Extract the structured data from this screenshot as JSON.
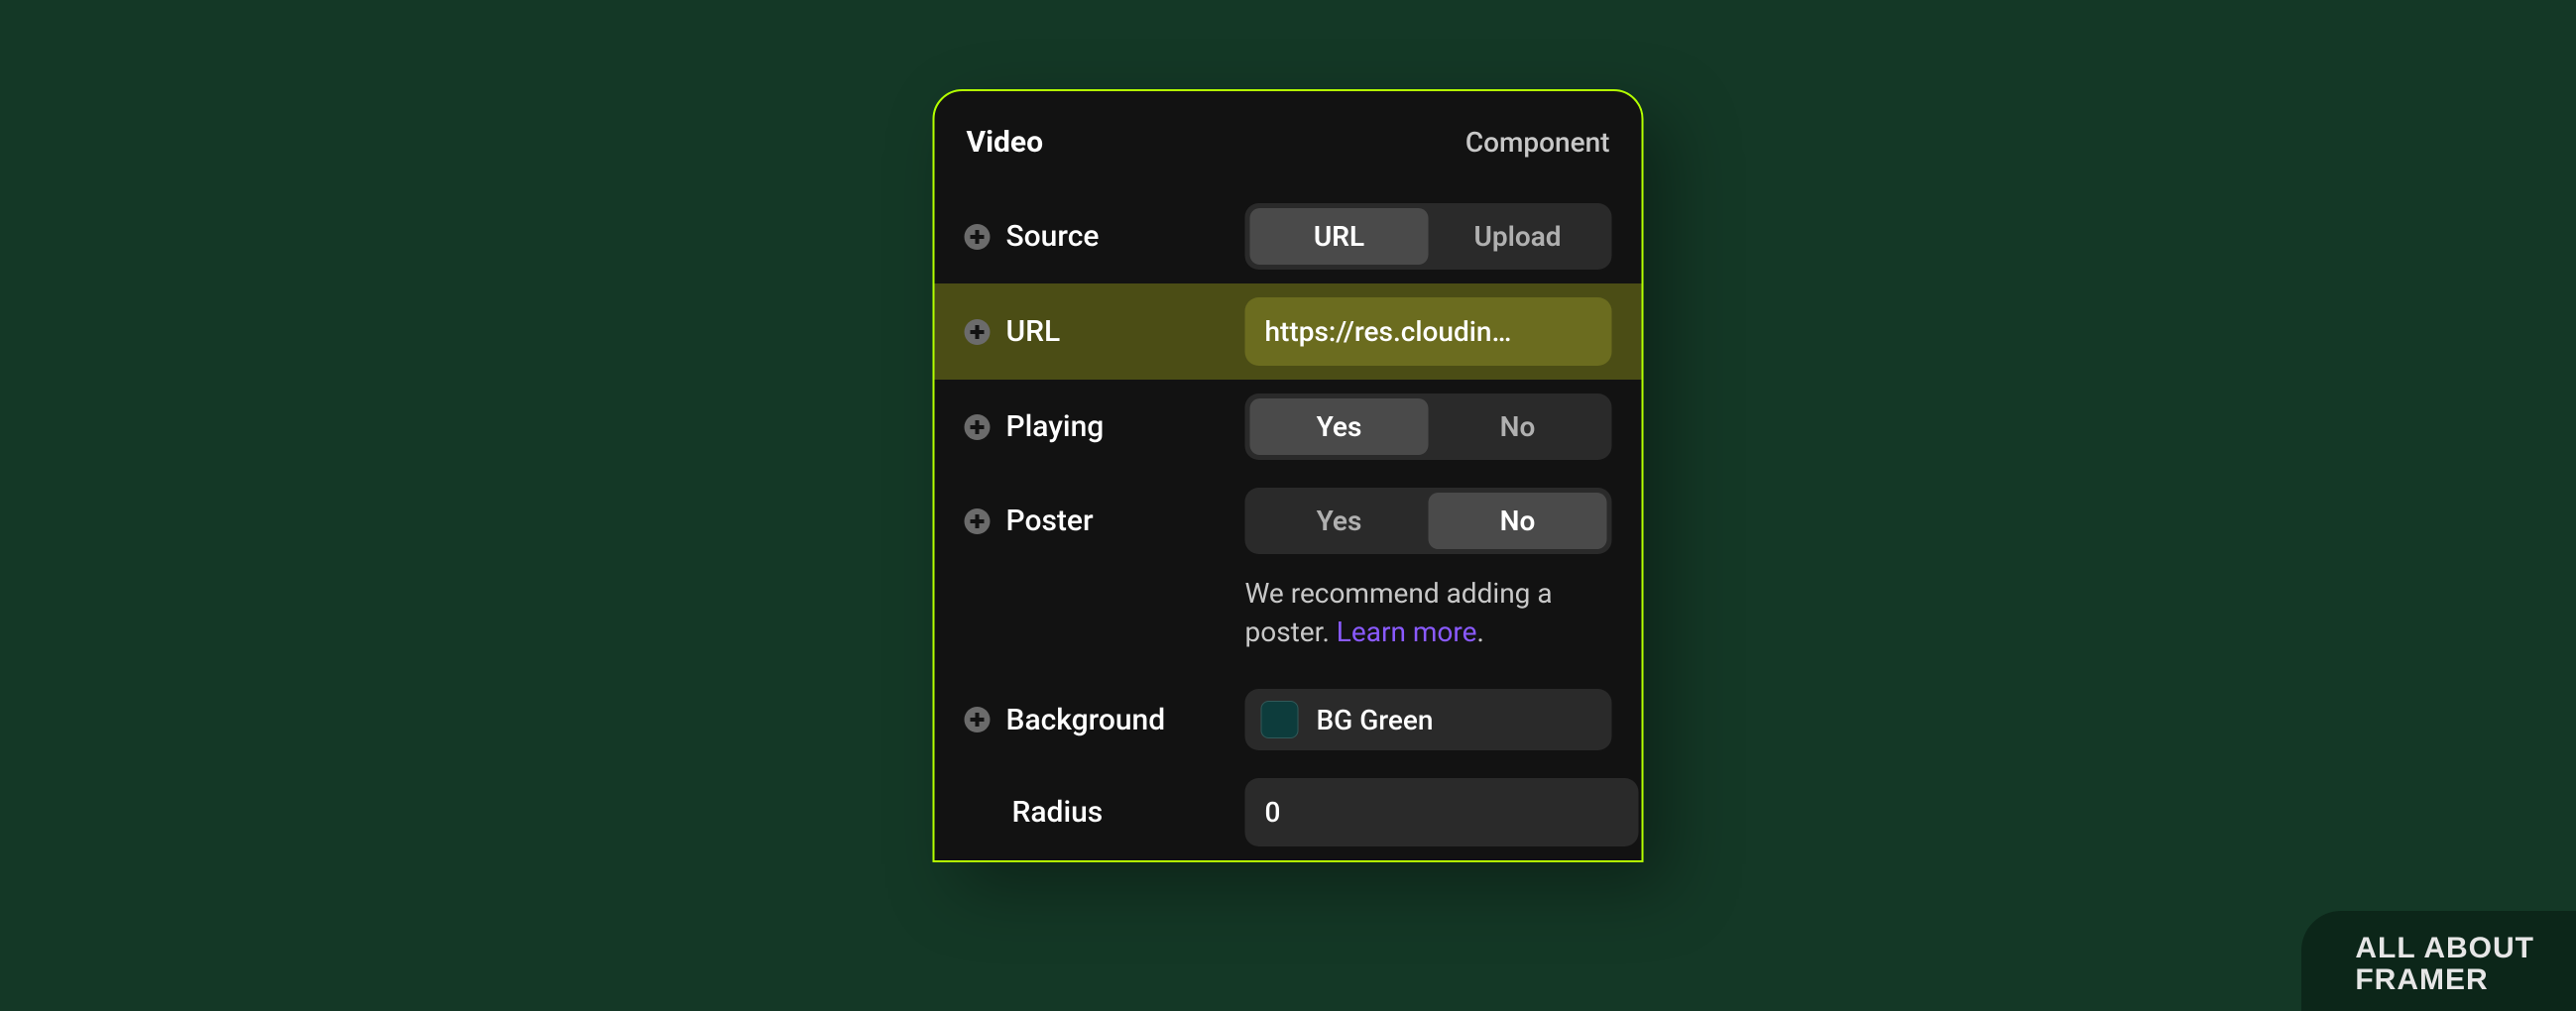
{
  "panel": {
    "title": "Video",
    "type_label": "Component"
  },
  "rows": {
    "source": {
      "label": "Source",
      "options": {
        "url": "URL",
        "upload": "Upload"
      }
    },
    "url": {
      "label": "URL",
      "value": "https://res.cloudin…"
    },
    "playing": {
      "label": "Playing",
      "options": {
        "yes": "Yes",
        "no": "No"
      }
    },
    "poster": {
      "label": "Poster",
      "options": {
        "yes": "Yes",
        "no": "No"
      }
    },
    "hint": {
      "text": "We recommend adding a poster. ",
      "link": "Learn more",
      "period": "."
    },
    "background": {
      "label": "Background",
      "color_name": "BG Green",
      "swatch_hex": "#0d3c3c"
    },
    "radius": {
      "label": "Radius",
      "value": "0"
    }
  },
  "brand": {
    "line1": "ALL ABOUT",
    "line2": "FRAMER"
  }
}
